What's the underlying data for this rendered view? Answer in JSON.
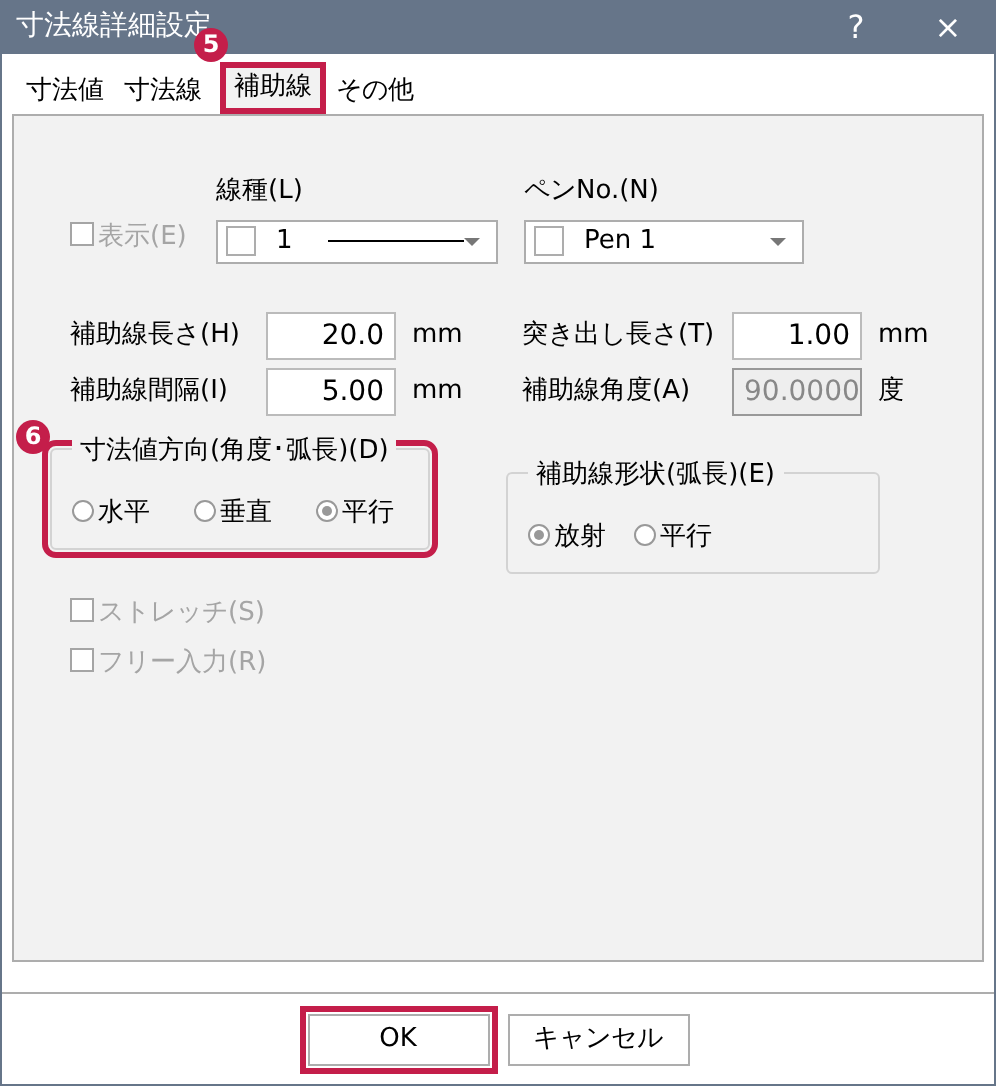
{
  "window": {
    "title": "寸法線詳細設定",
    "help": "?",
    "close": "×"
  },
  "tabs": [
    {
      "label": "寸法値",
      "selected": false,
      "highlighted": false
    },
    {
      "label": "寸法線",
      "selected": false,
      "highlighted": false
    },
    {
      "label": "補助線",
      "selected": true,
      "highlighted": true,
      "callout": "5"
    },
    {
      "label": "その他",
      "selected": false,
      "highlighted": false
    }
  ],
  "display_checkbox": {
    "label": "表示(E)",
    "checked": false,
    "disabled": true
  },
  "line_type": {
    "label": "線種(L)",
    "value": "1"
  },
  "pen": {
    "label": "ペンNo.(N)",
    "value": "Pen 1"
  },
  "fields": [
    {
      "label": "補助線長さ(H)",
      "value": "20.0",
      "unit": "mm",
      "disabled": false
    },
    {
      "label": "突き出し長さ(T)",
      "value": "1.00",
      "unit": "mm",
      "disabled": false
    },
    {
      "label": "補助線間隔(I)",
      "value": "5.00",
      "unit": "mm",
      "disabled": false
    },
    {
      "label": "補助線角度(A)",
      "value": "90.0000",
      "unit": "度",
      "disabled": true
    }
  ],
  "groups": [
    {
      "title": "寸法値方向(角度･弧長)(D)",
      "highlighted": true,
      "callout": "6",
      "options": [
        {
          "label": "水平",
          "selected": false
        },
        {
          "label": "垂直",
          "selected": false
        },
        {
          "label": "平行",
          "selected": true
        }
      ]
    },
    {
      "title": "補助線形状(弧長)(E)",
      "highlighted": false,
      "options": [
        {
          "label": "放射",
          "selected": true
        },
        {
          "label": "平行",
          "selected": false
        }
      ]
    }
  ],
  "checkboxes": [
    {
      "label": "ストレッチ(S)",
      "checked": false,
      "disabled": true
    },
    {
      "label": "フリー入力(R)",
      "checked": false,
      "disabled": true
    }
  ],
  "buttons": [
    {
      "label": "OK",
      "highlighted": true
    },
    {
      "label": "キャンセル",
      "highlighted": false
    }
  ]
}
